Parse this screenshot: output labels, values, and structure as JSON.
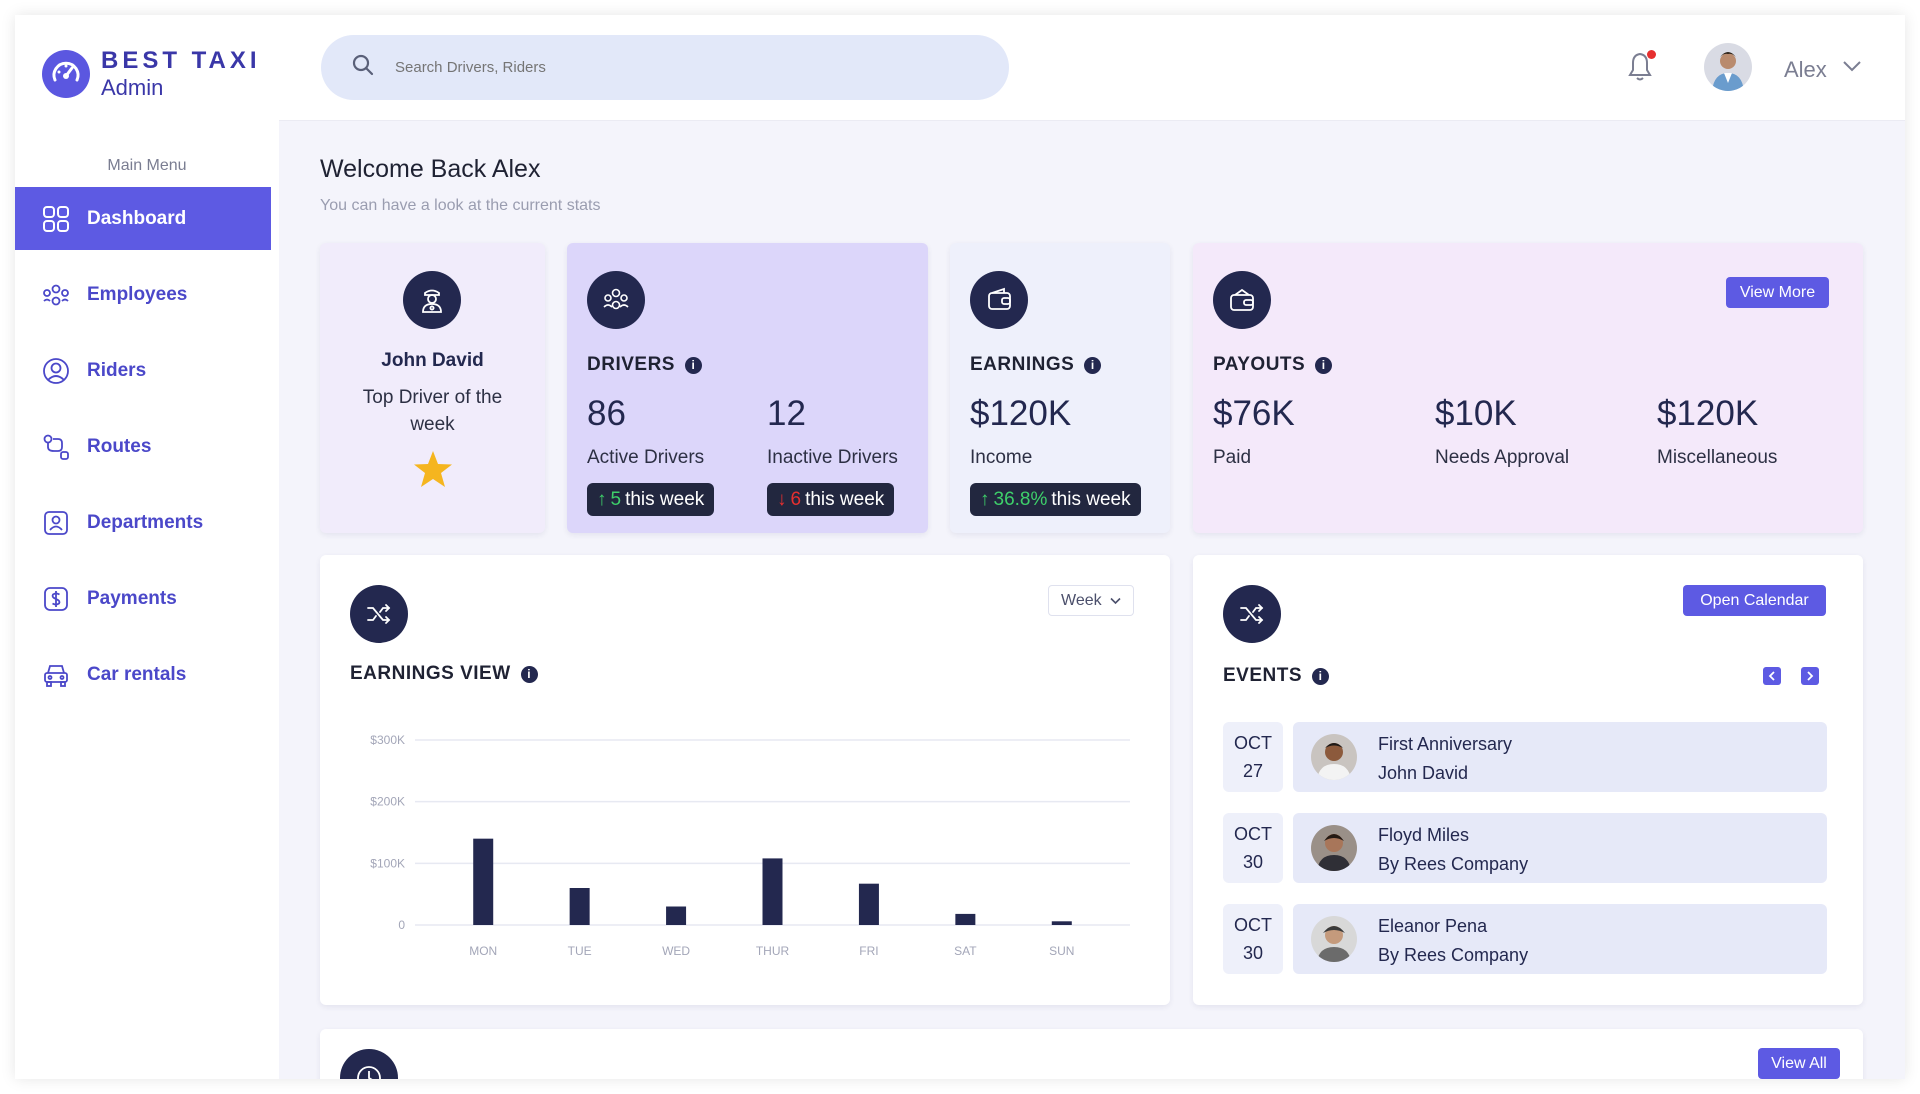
{
  "brand": {
    "title": "BEST TAXI",
    "subtitle": "Admin"
  },
  "sidebar": {
    "caption": "Main Menu",
    "items": [
      {
        "label": "Dashboard",
        "icon": "grid-icon",
        "active": true
      },
      {
        "label": "Employees",
        "icon": "employees-icon"
      },
      {
        "label": "Riders",
        "icon": "rider-icon"
      },
      {
        "label": "Routes",
        "icon": "routes-icon"
      },
      {
        "label": "Departments",
        "icon": "departments-icon"
      },
      {
        "label": "Payments",
        "icon": "dollar-icon"
      },
      {
        "label": "Car rentals",
        "icon": "car-icon"
      }
    ]
  },
  "header": {
    "search_placeholder": "Search Drivers, Riders",
    "user_name": "Alex"
  },
  "welcome": {
    "title": "Welcome Back Alex",
    "subtitle": "You can have a look at the current stats"
  },
  "top_driver": {
    "name": "John David",
    "caption": "Top Driver of the week"
  },
  "drivers": {
    "title": "DRIVERS",
    "active_value": "86",
    "active_label": "Active Drivers",
    "active_change": "5",
    "active_suffix": "this week",
    "inactive_value": "12",
    "inactive_label": "Inactive Drivers",
    "inactive_change": "6",
    "inactive_suffix": "this week"
  },
  "earnings": {
    "title": "EARNINGS",
    "value": "$120K",
    "label": "Income",
    "change": "36.8%",
    "suffix": "this week"
  },
  "payouts": {
    "title": "PAYOUTS",
    "button": "View More",
    "paid_value": "$76K",
    "paid_label": "Paid",
    "approval_value": "$10K",
    "approval_label": "Needs Approval",
    "misc_value": "$120K",
    "misc_label": "Miscellaneous"
  },
  "earnings_view": {
    "title": "EARNINGS VIEW",
    "period": "Week"
  },
  "chart_data": {
    "type": "bar",
    "title": "EARNINGS VIEW",
    "categories": [
      "MON",
      "TUE",
      "WED",
      "THUR",
      "FRI",
      "SAT",
      "SUN"
    ],
    "values": [
      140000,
      60000,
      30000,
      108000,
      67000,
      18000,
      6000
    ],
    "yticks": [
      "0",
      "$100K",
      "$200K",
      "$300K"
    ],
    "ylim": [
      0,
      300000
    ],
    "grid": true,
    "bar_color": "#23284f"
  },
  "events": {
    "title": "EVENTS",
    "button": "Open Calendar",
    "items": [
      {
        "month": "OCT",
        "day": "27",
        "title": "First Anniversary",
        "subtitle": "John David"
      },
      {
        "month": "OCT",
        "day": "30",
        "title": "Floyd Miles",
        "subtitle": "By Rees Company"
      },
      {
        "month": "OCT",
        "day": "30",
        "title": "Eleanor Pena",
        "subtitle": "By Rees Company"
      }
    ]
  },
  "bottom": {
    "button": "View All"
  },
  "colors": {
    "accent": "#5d5ae3",
    "dark": "#23284f",
    "card_lavender": "#f1ecfb",
    "card_purple": "#dcd6fa",
    "card_blue": "#eef0fb",
    "card_pink": "#f4e9fa",
    "up": "#3ecf6a",
    "down": "#e62f2f"
  }
}
